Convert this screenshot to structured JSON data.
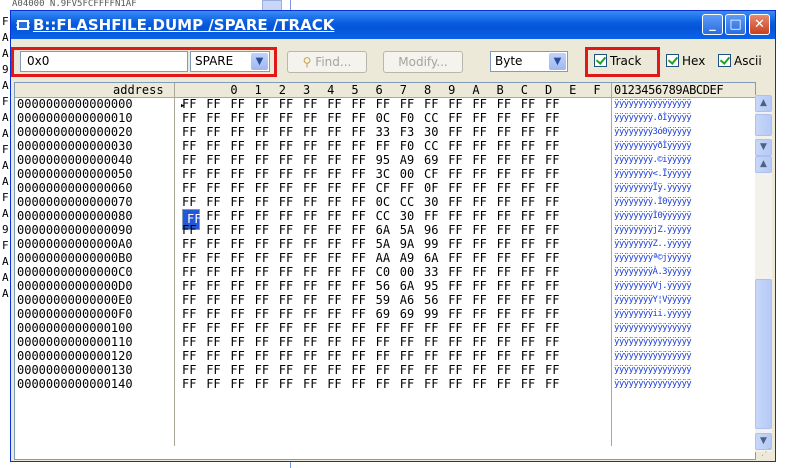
{
  "window": {
    "title": "B::FLASHFILE.DUMP /SPARE /TRACK",
    "minimize_glyph": "_",
    "maximize_glyph": "□",
    "close_glyph": "✕"
  },
  "toolbar": {
    "address_value": "0x0",
    "mode_select": "SPARE",
    "find_label": "Find...",
    "modify_label": "Modify...",
    "width_select": "Byte",
    "track_label": "Track",
    "track_checked": true,
    "hex_label": "Hex",
    "hex_checked": true,
    "ascii_label": "Ascii",
    "ascii_checked": true
  },
  "header": {
    "address_label": "address",
    "columns": [
      "0",
      "1",
      "2",
      "3",
      "4",
      "5",
      "6",
      "7",
      "8",
      "9",
      "A",
      "B",
      "C",
      "D",
      "E",
      "F"
    ],
    "ascii_label": "0123456789ABCDEF"
  },
  "rows": [
    {
      "addr": "0000000000000000",
      "bytes": [
        "FF",
        "FF",
        "FF",
        "FF",
        "FF",
        "FF",
        "FF",
        "FF",
        "FF",
        "FF",
        "FF",
        "FF",
        "FF",
        "FF",
        "FF",
        "FF"
      ],
      "ascii": "ÿÿÿÿÿÿÿÿÿÿÿÿÿÿÿÿ"
    },
    {
      "addr": "0000000000000010",
      "bytes": [
        "FF",
        "FF",
        "FF",
        "FF",
        "FF",
        "FF",
        "FF",
        "FF",
        "0C",
        "F0",
        "CC",
        "FF",
        "FF",
        "FF",
        "FF",
        "FF"
      ],
      "ascii": "ÿÿÿÿÿÿÿÿ.ðÌÿÿÿÿÿ"
    },
    {
      "addr": "0000000000000020",
      "bytes": [
        "FF",
        "FF",
        "FF",
        "FF",
        "FF",
        "FF",
        "FF",
        "FF",
        "33",
        "F3",
        "30",
        "FF",
        "FF",
        "FF",
        "FF",
        "FF"
      ],
      "ascii": "ÿÿÿÿÿÿÿÿ3ó0ÿÿÿÿÿ"
    },
    {
      "addr": "0000000000000030",
      "bytes": [
        "FF",
        "FF",
        "FF",
        "FF",
        "FF",
        "FF",
        "FF",
        "FF",
        "FF",
        "F0",
        "CC",
        "FF",
        "FF",
        "FF",
        "FF",
        "FF"
      ],
      "ascii": "ÿÿÿÿÿÿÿÿÿðÌÿÿÿÿÿ"
    },
    {
      "addr": "0000000000000040",
      "bytes": [
        "FF",
        "FF",
        "FF",
        "FF",
        "FF",
        "FF",
        "FF",
        "FF",
        "95",
        "A9",
        "69",
        "FF",
        "FF",
        "FF",
        "FF",
        "FF"
      ],
      "ascii": "ÿÿÿÿÿÿÿÿ.©iÿÿÿÿÿ"
    },
    {
      "addr": "0000000000000050",
      "bytes": [
        "FF",
        "FF",
        "FF",
        "FF",
        "FF",
        "FF",
        "FF",
        "FF",
        "3C",
        "00",
        "CF",
        "FF",
        "FF",
        "FF",
        "FF",
        "FF"
      ],
      "ascii": "ÿÿÿÿÿÿÿÿ<.Ïÿÿÿÿÿ"
    },
    {
      "addr": "0000000000000060",
      "bytes": [
        "FF",
        "FF",
        "FF",
        "FF",
        "FF",
        "FF",
        "FF",
        "FF",
        "CF",
        "FF",
        "0F",
        "FF",
        "FF",
        "FF",
        "FF",
        "FF"
      ],
      "ascii": "ÿÿÿÿÿÿÿÿÏÿ.ÿÿÿÿÿ"
    },
    {
      "addr": "0000000000000070",
      "bytes": [
        "FF",
        "FF",
        "FF",
        "FF",
        "FF",
        "FF",
        "FF",
        "FF",
        "0C",
        "CC",
        "30",
        "FF",
        "FF",
        "FF",
        "FF",
        "FF"
      ],
      "ascii": "ÿÿÿÿÿÿÿÿ.Ì0ÿÿÿÿÿ"
    },
    {
      "addr": "0000000000000080",
      "bytes": [
        "FF",
        "FF",
        "FF",
        "FF",
        "FF",
        "FF",
        "FF",
        "FF",
        "CC",
        "30",
        "FF",
        "FF",
        "FF",
        "FF",
        "FF",
        "FF"
      ],
      "ascii": "ÿÿÿÿÿÿÿÿÌ0ÿÿÿÿÿÿ"
    },
    {
      "addr": "0000000000000090",
      "bytes": [
        "FF",
        "FF",
        "FF",
        "FF",
        "FF",
        "FF",
        "FF",
        "FF",
        "6A",
        "5A",
        "96",
        "FF",
        "FF",
        "FF",
        "FF",
        "FF"
      ],
      "ascii": "ÿÿÿÿÿÿÿÿjZ.ÿÿÿÿÿ"
    },
    {
      "addr": "00000000000000A0",
      "bytes": [
        "FF",
        "FF",
        "FF",
        "FF",
        "FF",
        "FF",
        "FF",
        "FF",
        "5A",
        "9A",
        "99",
        "FF",
        "FF",
        "FF",
        "FF",
        "FF"
      ],
      "ascii": "ÿÿÿÿÿÿÿÿZ..ÿÿÿÿÿ"
    },
    {
      "addr": "00000000000000B0",
      "bytes": [
        "FF",
        "FF",
        "FF",
        "FF",
        "FF",
        "FF",
        "FF",
        "FF",
        "AA",
        "A9",
        "6A",
        "FF",
        "FF",
        "FF",
        "FF",
        "FF"
      ],
      "ascii": "ÿÿÿÿÿÿÿÿª©jÿÿÿÿÿ"
    },
    {
      "addr": "00000000000000C0",
      "bytes": [
        "FF",
        "FF",
        "FF",
        "FF",
        "FF",
        "FF",
        "FF",
        "FF",
        "C0",
        "00",
        "33",
        "FF",
        "FF",
        "FF",
        "FF",
        "FF"
      ],
      "ascii": "ÿÿÿÿÿÿÿÿÀ.3ÿÿÿÿÿ"
    },
    {
      "addr": "00000000000000D0",
      "bytes": [
        "FF",
        "FF",
        "FF",
        "FF",
        "FF",
        "FF",
        "FF",
        "FF",
        "56",
        "6A",
        "95",
        "FF",
        "FF",
        "FF",
        "FF",
        "FF"
      ],
      "ascii": "ÿÿÿÿÿÿÿÿVj.ÿÿÿÿÿ"
    },
    {
      "addr": "00000000000000E0",
      "bytes": [
        "FF",
        "FF",
        "FF",
        "FF",
        "FF",
        "FF",
        "FF",
        "FF",
        "59",
        "A6",
        "56",
        "FF",
        "FF",
        "FF",
        "FF",
        "FF"
      ],
      "ascii": "ÿÿÿÿÿÿÿÿY¦Vÿÿÿÿÿ"
    },
    {
      "addr": "00000000000000F0",
      "bytes": [
        "FF",
        "FF",
        "FF",
        "FF",
        "FF",
        "FF",
        "FF",
        "FF",
        "69",
        "69",
        "99",
        "FF",
        "FF",
        "FF",
        "FF",
        "FF"
      ],
      "ascii": "ÿÿÿÿÿÿÿÿii.ÿÿÿÿÿ"
    },
    {
      "addr": "0000000000000100",
      "bytes": [
        "FF",
        "FF",
        "FF",
        "FF",
        "FF",
        "FF",
        "FF",
        "FF",
        "FF",
        "FF",
        "FF",
        "FF",
        "FF",
        "FF",
        "FF",
        "FF"
      ],
      "ascii": "ÿÿÿÿÿÿÿÿÿÿÿÿÿÿÿÿ"
    },
    {
      "addr": "0000000000000110",
      "bytes": [
        "FF",
        "FF",
        "FF",
        "FF",
        "FF",
        "FF",
        "FF",
        "FF",
        "FF",
        "FF",
        "FF",
        "FF",
        "FF",
        "FF",
        "FF",
        "FF"
      ],
      "ascii": "ÿÿÿÿÿÿÿÿÿÿÿÿÿÿÿÿ"
    },
    {
      "addr": "0000000000000120",
      "bytes": [
        "FF",
        "FF",
        "FF",
        "FF",
        "FF",
        "FF",
        "FF",
        "FF",
        "FF",
        "FF",
        "FF",
        "FF",
        "FF",
        "FF",
        "FF",
        "FF"
      ],
      "ascii": "ÿÿÿÿÿÿÿÿÿÿÿÿÿÿÿÿ"
    },
    {
      "addr": "0000000000000130",
      "bytes": [
        "FF",
        "FF",
        "FF",
        "FF",
        "FF",
        "FF",
        "FF",
        "FF",
        "FF",
        "FF",
        "FF",
        "FF",
        "FF",
        "FF",
        "FF",
        "FF"
      ],
      "ascii": "ÿÿÿÿÿÿÿÿÿÿÿÿÿÿÿÿ"
    },
    {
      "addr": "0000000000000140",
      "bytes": [
        "FF",
        "FF",
        "FF",
        "FF",
        "FF",
        "FF",
        "FF",
        "FF",
        "FF",
        "FF",
        "FF",
        "FF",
        "FF",
        "FF",
        "FF",
        "FF"
      ],
      "ascii": "ÿÿÿÿÿÿÿÿÿÿÿÿÿÿÿÿ"
    }
  ],
  "selected_cell": {
    "row": 8,
    "col": 0
  },
  "background_window": {
    "side_letters": [
      "F",
      "A",
      "A",
      "9",
      "A",
      "F",
      "A",
      "A",
      "F",
      "A",
      "A",
      "F",
      "A",
      "9",
      "F",
      "A",
      "A",
      "A"
    ],
    "top_text": "A04000 N.9FV5FCFFFFN1AF"
  },
  "colors": {
    "title_bar": "#0a5fe0",
    "highlight_box": "#e01818",
    "ascii_text": "#1c3fd8",
    "selection": "#2357d6"
  },
  "icons": {
    "title": "flash-memory-icon",
    "find": "binoculars-icon",
    "dropdown": "chevron-down-icon"
  }
}
